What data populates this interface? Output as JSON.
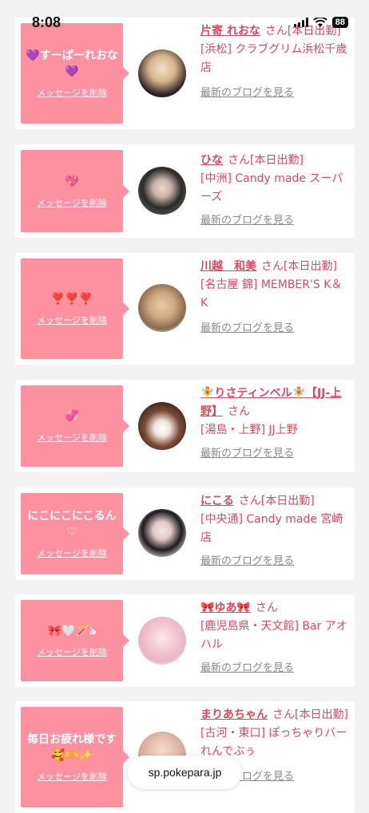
{
  "status": {
    "time": "8:08",
    "battery": "88"
  },
  "delete_label": "メッセージを削除",
  "blog_label": "最新のブログを見る",
  "url": "sp.pokepara.jp",
  "cards": [
    {
      "message": "💜すーぱーれおな💜",
      "name": "片寄 れおな",
      "suffix": "さん[本日出勤]",
      "shop": "[浜松] クラブグリム浜松千歳店"
    },
    {
      "message": "💖",
      "name": "ひな",
      "suffix": "さん[本日出勤]",
      "shop": "[中洲] Candy made スーパーズ"
    },
    {
      "message": "❣️❣️❣️",
      "name": "川越　和美",
      "suffix": "さん[本日出勤]",
      "shop": "[名古屋 錦] MEMBER'S K＆K"
    },
    {
      "message": "💞",
      "name": "🧚りさティンベル🧚【JJ-上野】",
      "suffix": "さん",
      "shop": "[湯島・上野] JJ上野"
    },
    {
      "message": "にこにこにこるん♡",
      "name": "にこる",
      "suffix": "さん[本日出勤]",
      "shop": "[中央通] Candy made 宮崎店"
    },
    {
      "message": "🎀🤍🪄ঌ",
      "name": "🎀ゆあ🎀",
      "suffix": "さん",
      "shop": "[鹿児島県・天文館] Bar アオハル"
    },
    {
      "message": "毎日お疲れ様です🥰🫶✨",
      "name": "まりあちゃん",
      "suffix": "さん[本日出勤]",
      "shop": "[古河・東口] ぽっちゃりバー れんでぶぅ"
    }
  ]
}
